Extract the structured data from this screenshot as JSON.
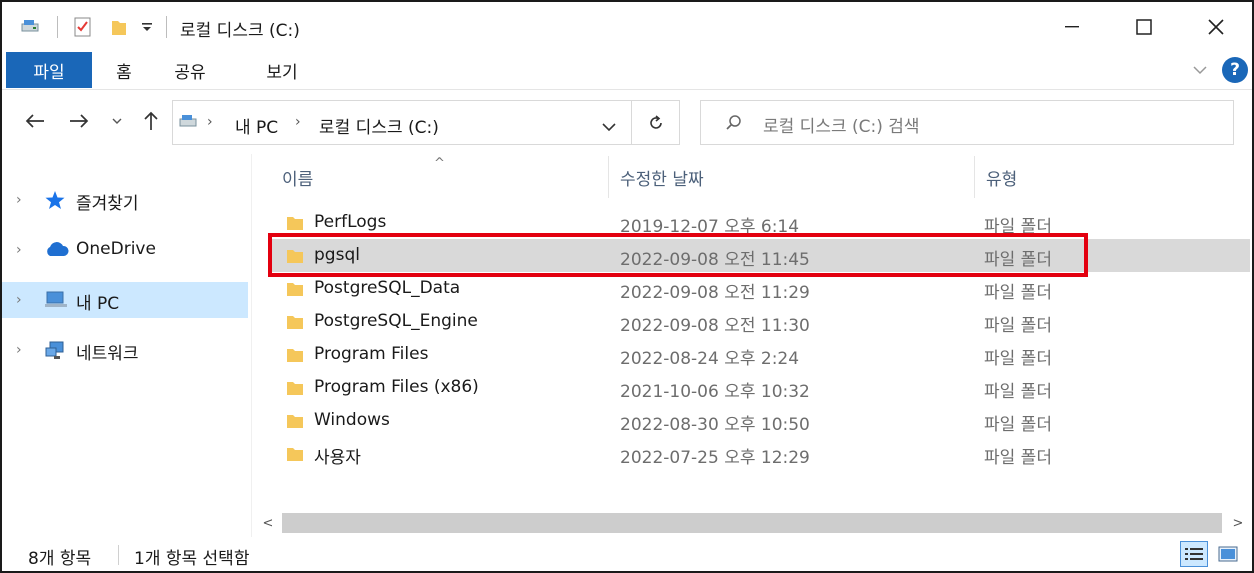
{
  "window": {
    "title": "로컬 디스크 (C:)"
  },
  "ribbon": {
    "tabs": [
      "파일",
      "홈",
      "공유",
      "보기"
    ]
  },
  "address": {
    "crumbs": [
      "내 PC",
      "로컬 디스크 (C:)"
    ],
    "search_placeholder": "로컬 디스크 (C:) 검색"
  },
  "nav_pane": {
    "items": [
      {
        "label": "즐겨찾기",
        "icon": "star-icon"
      },
      {
        "label": "OneDrive",
        "icon": "cloud-icon"
      },
      {
        "label": "내 PC",
        "icon": "computer-icon"
      },
      {
        "label": "네트워크",
        "icon": "network-icon"
      }
    ],
    "selected": "내 PC"
  },
  "columns": {
    "name": "이름",
    "date": "수정한 날짜",
    "type": "유형"
  },
  "files": [
    {
      "name": "PerfLogs",
      "date": "2019-12-07 오후 6:14",
      "type": "파일 폴더"
    },
    {
      "name": "pgsql",
      "date": "2022-09-08 오전 11:45",
      "type": "파일 폴더"
    },
    {
      "name": "PostgreSQL_Data",
      "date": "2022-09-08 오전 11:29",
      "type": "파일 폴더"
    },
    {
      "name": "PostgreSQL_Engine",
      "date": "2022-09-08 오전 11:30",
      "type": "파일 폴더"
    },
    {
      "name": "Program Files",
      "date": "2022-08-24 오후 2:24",
      "type": "파일 폴더"
    },
    {
      "name": "Program Files (x86)",
      "date": "2021-10-06 오후 10:32",
      "type": "파일 폴더"
    },
    {
      "name": "Windows",
      "date": "2022-08-30 오후 10:50",
      "type": "파일 폴더"
    },
    {
      "name": "사용자",
      "date": "2022-07-25 오후 12:29",
      "type": "파일 폴더"
    }
  ],
  "selected_file": "pgsql",
  "status": {
    "count": "8개 항목",
    "selection": "1개 항목 선택함"
  },
  "colors": {
    "accent": "#1a67b8",
    "highlight": "#e3000f",
    "folder": "#f5c75a"
  }
}
